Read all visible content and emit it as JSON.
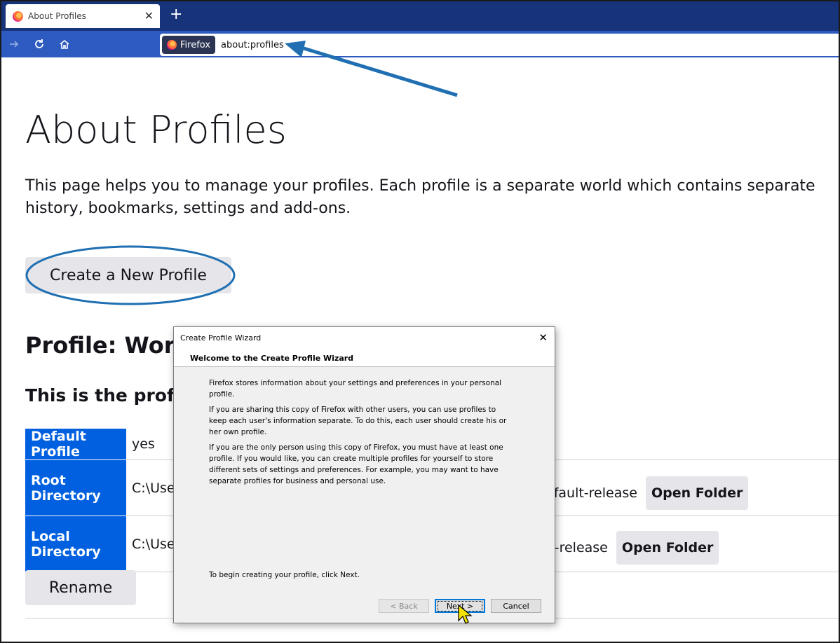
{
  "browser": {
    "tab": {
      "title": "About Profiles",
      "close": "✕"
    },
    "newtab": "+",
    "identity_label": "Firefox",
    "url": "about:profiles"
  },
  "page": {
    "title": "About Profiles",
    "intro": "This page helps you to manage your profiles. Each profile is a separate world which contains separate history, bookmarks, settings and add-ons.",
    "create_button": "Create a New Profile",
    "profile_heading": "Profile: Work",
    "profile_subheading": "This is the profil",
    "rows": [
      {
        "key": "Default Profile",
        "value": "yes"
      },
      {
        "key": "Root Directory",
        "value": "C:\\Use",
        "value_tail": "efault-release",
        "button": "Open Folder"
      },
      {
        "key": "Local Directory",
        "value": "C:\\Use",
        "value_tail": "lt-release",
        "button": "Open Folder"
      }
    ],
    "rename_button": "Rename"
  },
  "dialog": {
    "title": "Create Profile Wizard",
    "close": "✕",
    "heading": "Welcome to the Create Profile Wizard",
    "paragraphs": [
      "Firefox stores information about your settings and preferences in your personal profile.",
      "If you are sharing this copy of Firefox with other users, you can use profiles to keep each user's information separate. To do this, each user should create his or her own profile.",
      "If you are the only person using this copy of Firefox, you must have at least one profile. If you would like, you can create multiple profiles for yourself to store different sets of settings and preferences. For example, you may want to have separate profiles for business and personal use."
    ],
    "footer": "To begin creating your profile, click Next.",
    "back_button": "< Back",
    "next_button": "Next >",
    "cancel_button": "Cancel"
  },
  "colors": {
    "tabstrip": "#17337a",
    "toolbar": "#2e5bbf",
    "accent": "#0060df",
    "annotation": "#1f6fb2"
  }
}
